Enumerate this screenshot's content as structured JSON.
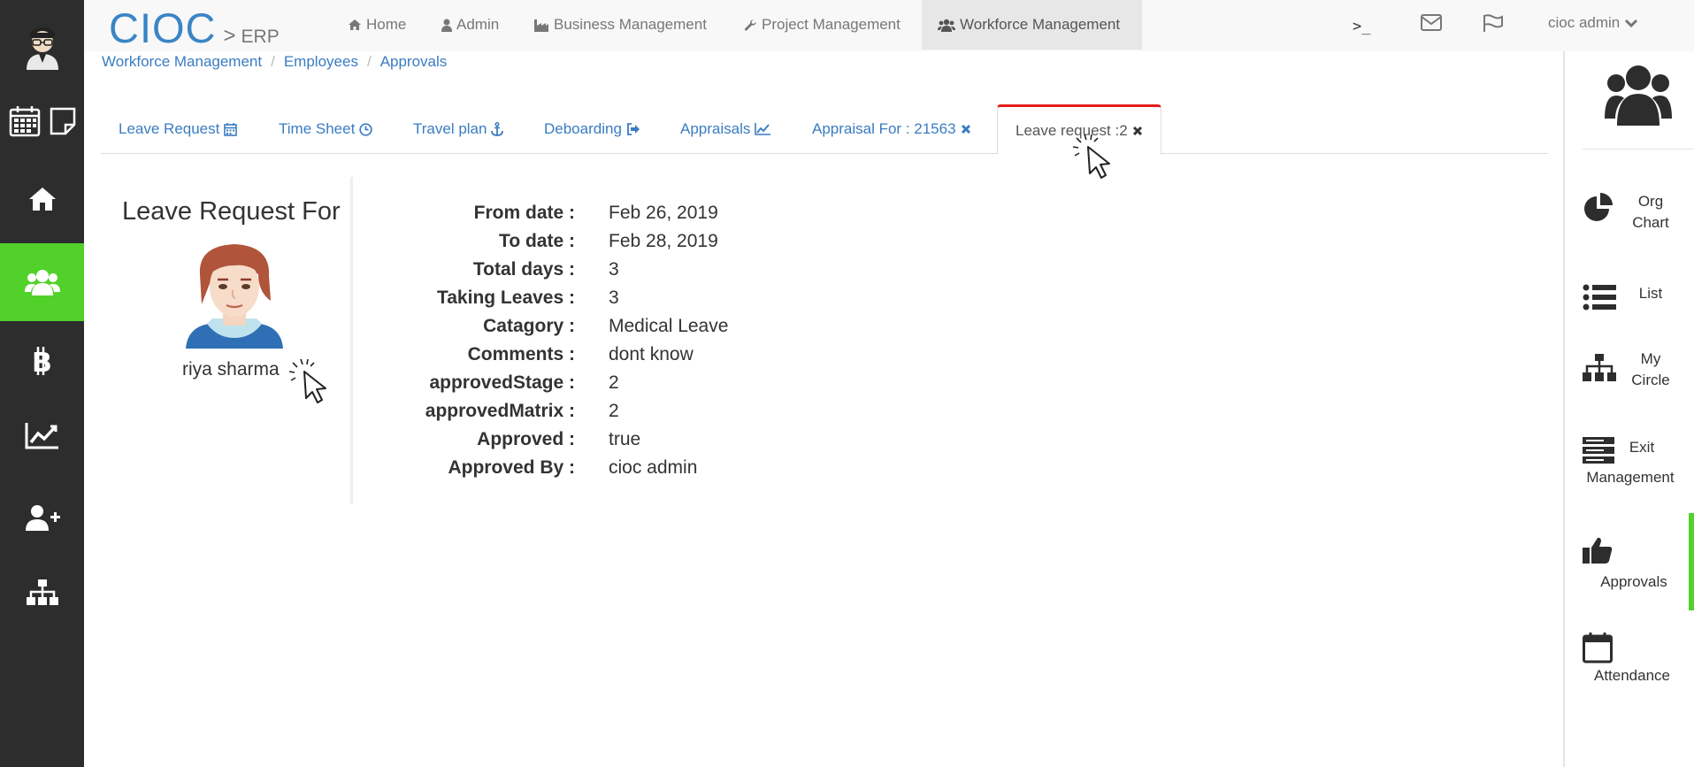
{
  "navbar": {
    "brand": "CIOC",
    "brand_sep": ">",
    "brand_sub": "ERP",
    "items": [
      {
        "label": "Home",
        "icon": "home-icon"
      },
      {
        "label": "Admin",
        "icon": "user-icon"
      },
      {
        "label": "Business Management",
        "icon": "industry-icon"
      },
      {
        "label": "Project Management",
        "icon": "wrench-icon"
      },
      {
        "label": "Workforce Management",
        "icon": "users-icon"
      }
    ],
    "terminal_label": ">_",
    "user_label": "cioc admin"
  },
  "breadcrumb": [
    "Workforce Management",
    "Employees",
    "Approvals"
  ],
  "tabs": [
    {
      "label": "Leave Request",
      "icon": "calendar-icon"
    },
    {
      "label": "Time Sheet",
      "icon": "clock-icon"
    },
    {
      "label": "Travel plan",
      "icon": "anchor-icon"
    },
    {
      "label": "Deboarding",
      "icon": "sign-out-icon"
    },
    {
      "label": "Appraisals",
      "icon": "line-chart-icon"
    },
    {
      "label": "Appraisal For : 21563",
      "icon": "close-icon"
    },
    {
      "label": "Leave request :2",
      "icon": "close-icon"
    }
  ],
  "profile": {
    "title": "Leave Request For",
    "name": "riya sharma"
  },
  "details": [
    {
      "label": "From date :",
      "value": "Feb 26, 2019"
    },
    {
      "label": "To date :",
      "value": "Feb 28, 2019"
    },
    {
      "label": "Total days :",
      "value": "3"
    },
    {
      "label": "Taking Leaves :",
      "value": "3"
    },
    {
      "label": "Catagory :",
      "value": "Medical Leave"
    },
    {
      "label": "Comments :",
      "value": "dont know"
    },
    {
      "label": "approvedStage :",
      "value": "2"
    },
    {
      "label": "approvedMatrix :",
      "value": "2"
    },
    {
      "label": "Approved :",
      "value": "true"
    },
    {
      "label": "Approved By :",
      "value": "cioc admin"
    }
  ],
  "right_sidebar": {
    "items": [
      {
        "label1": "Org",
        "label2": "Chart",
        "icon": "pie-chart-icon"
      },
      {
        "label1": "List",
        "label2": "",
        "icon": "list-icon"
      },
      {
        "label1": "My",
        "label2": "Circle",
        "icon": "sitemap-icon"
      },
      {
        "label1": "Exit",
        "label2": "Management",
        "icon": "server-icon"
      },
      {
        "label1": "",
        "label2": "Approvals",
        "icon": "thumbs-up-icon"
      },
      {
        "label1": "",
        "label2": "Attendance",
        "icon": "calendar-empty-icon"
      }
    ]
  },
  "colors": {
    "sidebar_bg": "#2d2d2d",
    "sidebar_active": "#52d12a",
    "brand_blue": "#3a85c6",
    "link_blue": "#3a7cc1",
    "active_tab_border": "#e31b1b"
  }
}
